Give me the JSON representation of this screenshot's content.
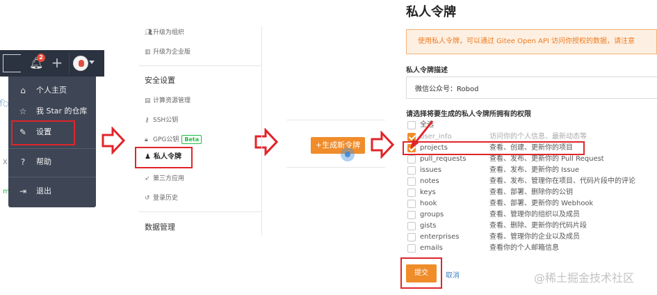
{
  "panel1": {
    "notification_count": "2",
    "menu_items": [
      {
        "icon": "home-icon",
        "glyph": "⌂",
        "label": "个人主页"
      },
      {
        "icon": "star-icon",
        "glyph": "☆",
        "label": "我 Star 的仓库"
      },
      {
        "icon": "settings-icon",
        "glyph": "✎",
        "label": "设置"
      },
      {
        "icon": "help-icon",
        "glyph": "?",
        "label": "帮助"
      },
      {
        "icon": "logout-icon",
        "glyph": "⇥",
        "label": "退出"
      }
    ],
    "fragment_1": "X",
    "fragment_2": "m"
  },
  "panel2": {
    "upgrade_org": "升级为组织",
    "upgrade_enterprise": "升级为企业版",
    "security_heading": "安全设置",
    "items": {
      "compute": "计算资源管理",
      "ssh": "SSH公钥",
      "gpg": "GPG公钥",
      "gpg_badge": "Beta",
      "tokens": "私人令牌",
      "third_party": "第三方应用",
      "login_history": "登录历史"
    },
    "data_heading": "数据管理"
  },
  "panel3": {
    "generate_button": "+生成新令牌"
  },
  "panel4": {
    "title": "私人令牌",
    "notice": "使用私人令牌，可以通过 Gitee Open API 访问你授权的数据，请注意",
    "desc_label": "私人令牌描述",
    "desc_value": "微信公众号：Robod",
    "perm_label": "请选择将要生成的私人令牌所拥有的权限",
    "select_all": "全选",
    "scopes": [
      {
        "scope": "user_info",
        "desc": "访问你的个人信息、最新动态等",
        "checked": true
      },
      {
        "scope": "projects",
        "desc": "查看、创建、更新你的项目",
        "checked": true
      },
      {
        "scope": "pull_requests",
        "desc": "查看、发布、更新你的 Pull Request",
        "checked": false
      },
      {
        "scope": "issues",
        "desc": "查看、发布、更新你的 Issue",
        "checked": false
      },
      {
        "scope": "notes",
        "desc": "查看、发布、管理你在项目、代码片段中的评论",
        "checked": false
      },
      {
        "scope": "keys",
        "desc": "查看、部署、删除你的公钥",
        "checked": false
      },
      {
        "scope": "hook",
        "desc": "查看、部署、更新你的 Webhook",
        "checked": false
      },
      {
        "scope": "groups",
        "desc": "查看、管理你的组织以及成员",
        "checked": false
      },
      {
        "scope": "gists",
        "desc": "查看、删除、更新你的代码片段",
        "checked": false
      },
      {
        "scope": "enterprises",
        "desc": "查看、管理你的企业以及成员",
        "checked": false
      },
      {
        "scope": "emails",
        "desc": "查看你的个人邮箱信息",
        "checked": false
      }
    ],
    "submit": "提交",
    "cancel": "取消",
    "watermark": "@稀土掘金技术社区"
  },
  "colors": {
    "accent_orange": "#f08c2a",
    "highlight_red": "#e0242a",
    "link_blue": "#4183c4",
    "menu_bg": "#3e4655"
  }
}
